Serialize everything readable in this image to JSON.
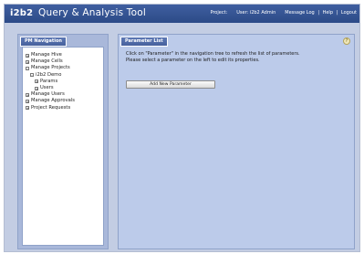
{
  "app": {
    "brand": "i2b2",
    "title": "Query & Analysis Tool"
  },
  "topnav": {
    "project": "Project:",
    "user": "User: i2b2 Admin",
    "message_log": "Message Log",
    "help": "Help",
    "logout": "Logout",
    "separator": "|"
  },
  "left_panel": {
    "title": "PM Navigation",
    "tree": [
      {
        "label": "Manage Hive",
        "toggle": "+"
      },
      {
        "label": "Manage Cells",
        "toggle": "+"
      },
      {
        "label": "Manage Projects",
        "toggle": "-"
      },
      {
        "label": "i2b2 Demo",
        "toggle": "-"
      },
      {
        "label": "Params",
        "toggle": "+"
      },
      {
        "label": "Users",
        "toggle": "+"
      },
      {
        "label": "Manage Users",
        "toggle": "+"
      },
      {
        "label": "Manage Approvals",
        "toggle": "+"
      },
      {
        "label": "Project Requests",
        "toggle": "+"
      }
    ]
  },
  "right_panel": {
    "title": "Parameter List",
    "help_glyph": "?",
    "line1": "Click on \"Parameter\" in the navigation tree to refresh the list of parameters.",
    "line2": "Please select a parameter on the left to edit its properties.",
    "add_button": "Add New Parameter"
  },
  "colors": {
    "topbar": "#2f4d8a",
    "panel_head": "#4f69a6",
    "background": "#c3cde3"
  }
}
